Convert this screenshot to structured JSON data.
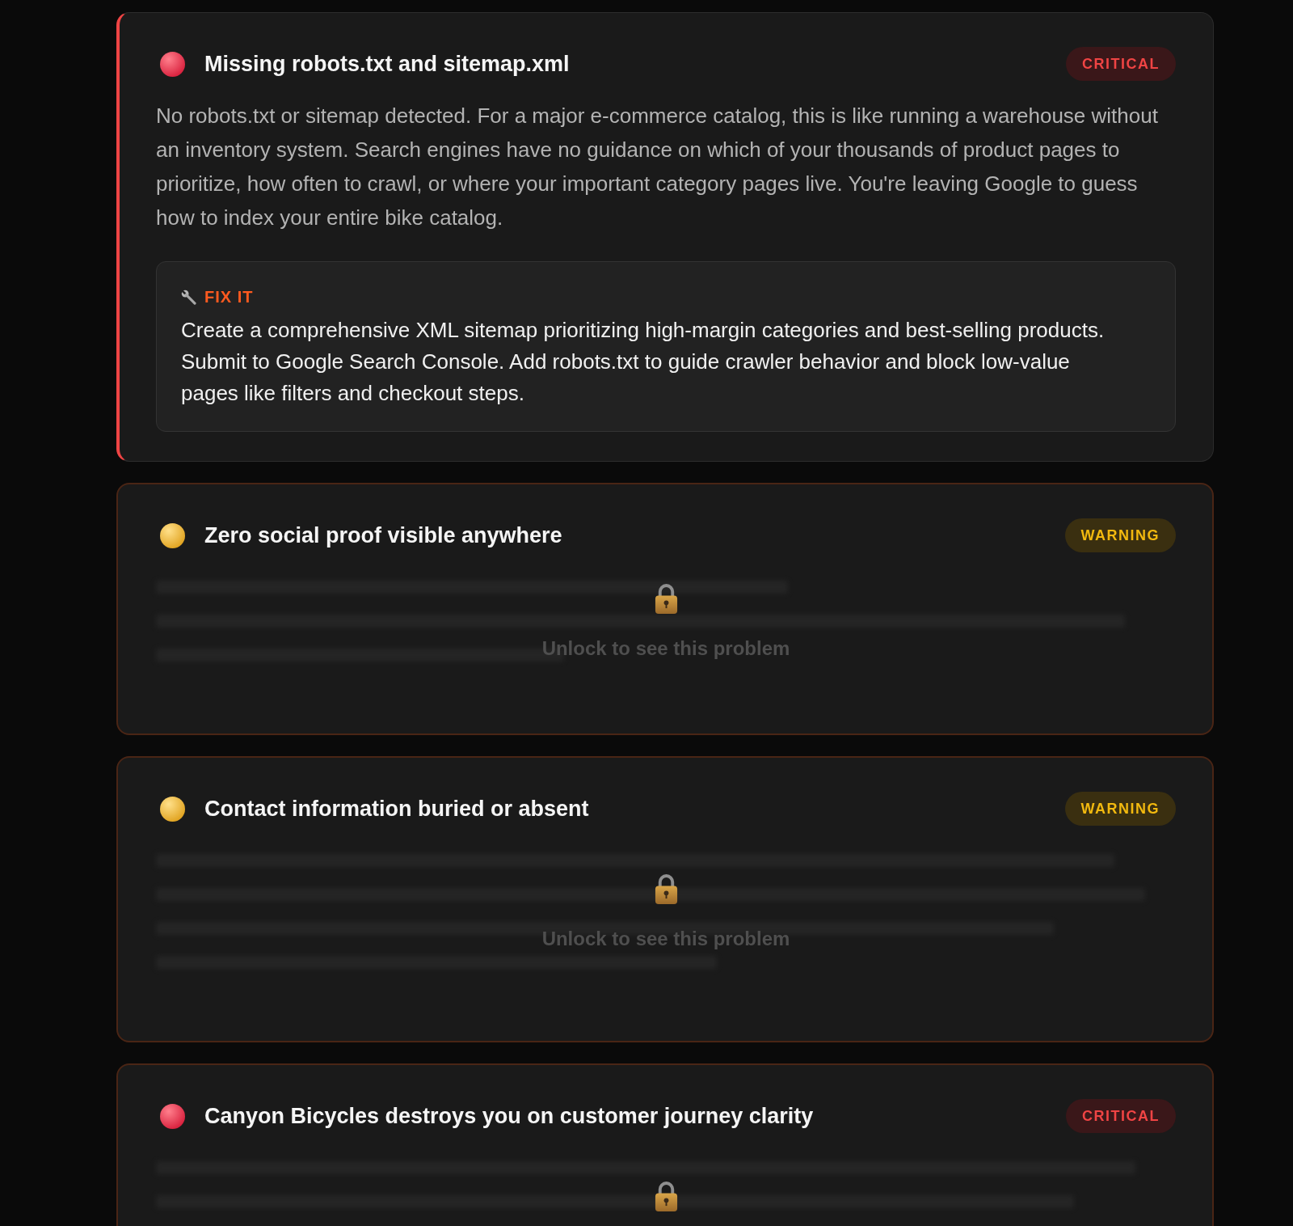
{
  "issues": [
    {
      "kind": "critical",
      "locked": false,
      "title": "Missing robots.txt and sitemap.xml",
      "badge": "CRITICAL",
      "description": "No robots.txt or sitemap detected. For a major e-commerce catalog, this is like running a warehouse without an inventory system. Search engines have no guidance on which of your thousands of product pages to prioritize, how often to crawl, or where your important category pages live. You're leaving Google to guess how to index your entire bike catalog.",
      "fix": {
        "label": "FIX IT",
        "text": "Create a comprehensive XML sitemap prioritizing high-margin categories and best-selling products. Submit to Google Search Console. Add robots.txt to guide crawler behavior and block low-value pages like filters and checkout steps."
      }
    },
    {
      "kind": "warning",
      "locked": true,
      "title": "Zero social proof visible anywhere",
      "badge": "WARNING",
      "lock_message": "Unlock to see this problem"
    },
    {
      "kind": "warning",
      "locked": true,
      "title": "Contact information buried or absent",
      "badge": "WARNING",
      "lock_message": "Unlock to see this problem"
    },
    {
      "kind": "critical",
      "locked": true,
      "title": "Canyon Bicycles destroys you on customer journey clarity",
      "badge": "CRITICAL"
    }
  ]
}
